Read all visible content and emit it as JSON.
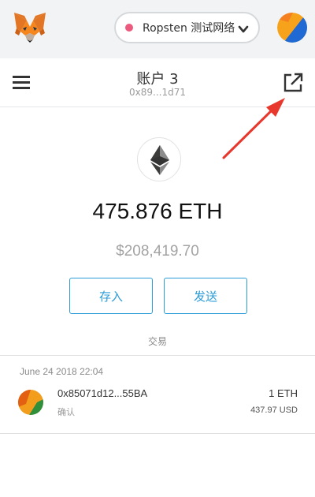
{
  "topbar": {
    "network_label": "Ropsten 测试网络",
    "network_color": "#ec5a7e"
  },
  "account": {
    "name": "账户 3",
    "address": "0x89...1d71"
  },
  "balance": {
    "eth": "475.876 ETH",
    "usd": "$208,419.70"
  },
  "actions": {
    "deposit_label": "存入",
    "send_label": "发送"
  },
  "tabs": {
    "transactions_label": "交易"
  },
  "transactions": [
    {
      "date": "June 24 2018 22:04",
      "address": "0x85071d12...55BA",
      "status": "确认",
      "amount": "1 ETH",
      "usd": "437.97 USD"
    }
  ],
  "colors": {
    "accent": "#2b9cd8",
    "annotation": "#e8372c"
  },
  "icons": {
    "logo": "metamask-fox-icon",
    "network_chevron": "chevron-down-icon",
    "menu": "hamburger-menu-icon",
    "external": "external-link-icon",
    "eth": "ethereum-icon"
  }
}
